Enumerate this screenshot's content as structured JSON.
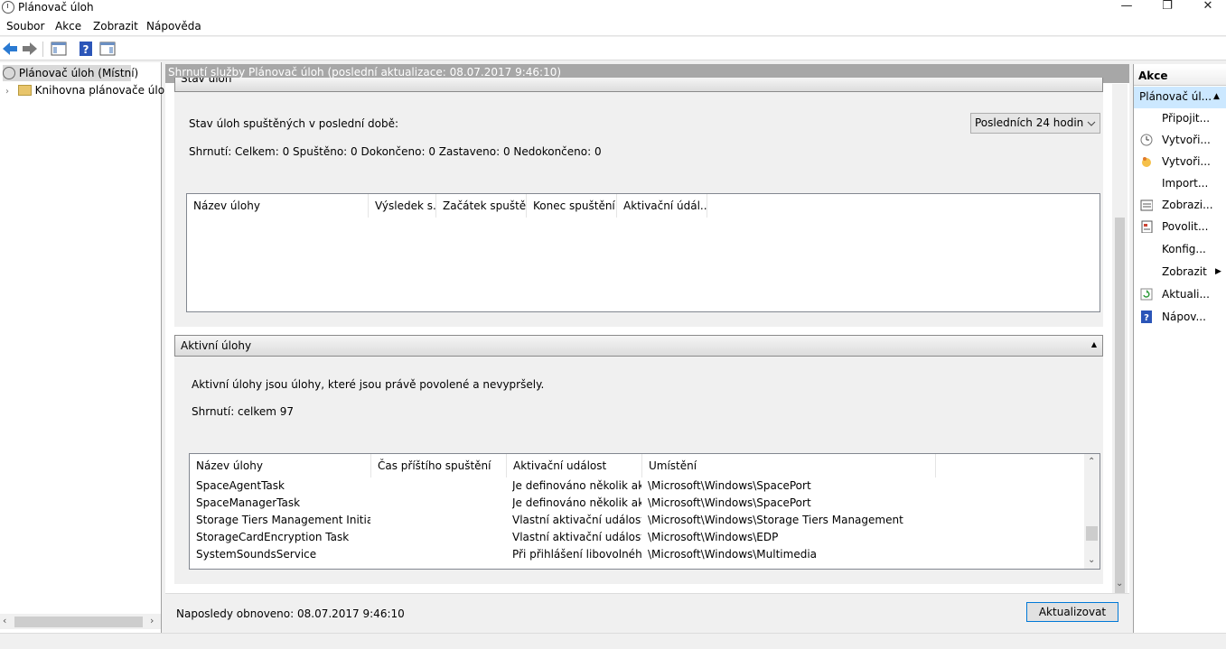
{
  "window": {
    "title": "Plánovač úloh",
    "minimize": "—",
    "restore": "❐",
    "close": "✕"
  },
  "menu": {
    "items": [
      "Soubor",
      "Akce",
      "Zobrazit",
      "Nápověda"
    ]
  },
  "tree": {
    "root": "Plánovač úloh (Místní)",
    "library": "Knihovna plánovače úloh"
  },
  "center": {
    "header": "Shrnutí služby Plánovač úloh (poslední aktualizace: 08.07.2017 9:46:10)",
    "status_section": {
      "title": "Stav úloh",
      "label": "Stav úloh spuštěných v poslední době:",
      "period_select": "Posledních 24 hodin",
      "summary": "Shrnutí: Celkem: 0 Spuštěno: 0 Dokončeno: 0 Zastaveno: 0 Nedokončeno: 0",
      "columns": [
        "Název úlohy",
        "Výsledek s...",
        "Začátek spuštění",
        "Konec spuštění",
        "Aktivační údál..."
      ]
    },
    "active_section": {
      "title": "Aktivní úlohy",
      "description": "Aktivní úlohy jsou úlohy, které jsou právě povolené a nevypršely.",
      "summary": "Shrnutí: celkem 97",
      "columns": [
        "Název úlohy",
        "Čas příštího spuštění",
        "Aktivační událost",
        "Umístění"
      ],
      "rows": [
        {
          "name": "SpaceAgentTask",
          "next": "",
          "trigger": "Je definováno několik ak...",
          "location": "\\Microsoft\\Windows\\SpacePort"
        },
        {
          "name": "SpaceManagerTask",
          "next": "",
          "trigger": "Je definováno několik ak...",
          "location": "\\Microsoft\\Windows\\SpacePort"
        },
        {
          "name": "Storage Tiers Management Initializ...",
          "next": "",
          "trigger": "Vlastní aktivační událost",
          "location": "\\Microsoft\\Windows\\Storage Tiers Management"
        },
        {
          "name": "StorageCardEncryption Task",
          "next": "",
          "trigger": "Vlastní aktivační událost",
          "location": "\\Microsoft\\Windows\\EDP"
        },
        {
          "name": "SystemSoundsService",
          "next": "",
          "trigger": "Při přihlášení libovolného...",
          "location": "\\Microsoft\\Windows\\Multimedia"
        }
      ]
    },
    "footer": {
      "last_refresh": "Naposledy obnoveno: 08.07.2017 9:46:10",
      "refresh_button": "Aktualizovat"
    }
  },
  "actions": {
    "title": "Akce",
    "group": "Plánovač úl...",
    "items": [
      "Připojit...",
      "Vytvoři...",
      "Vytvoři...",
      "Import...",
      "Zobrazi...",
      "Povolit...",
      "Konfig...",
      "Zobrazit",
      "Aktuali...",
      "Nápov..."
    ]
  },
  "colors": {
    "header_gray": "#a7a7a7",
    "accent": "#0078d7",
    "selected": "#cce8ff"
  }
}
